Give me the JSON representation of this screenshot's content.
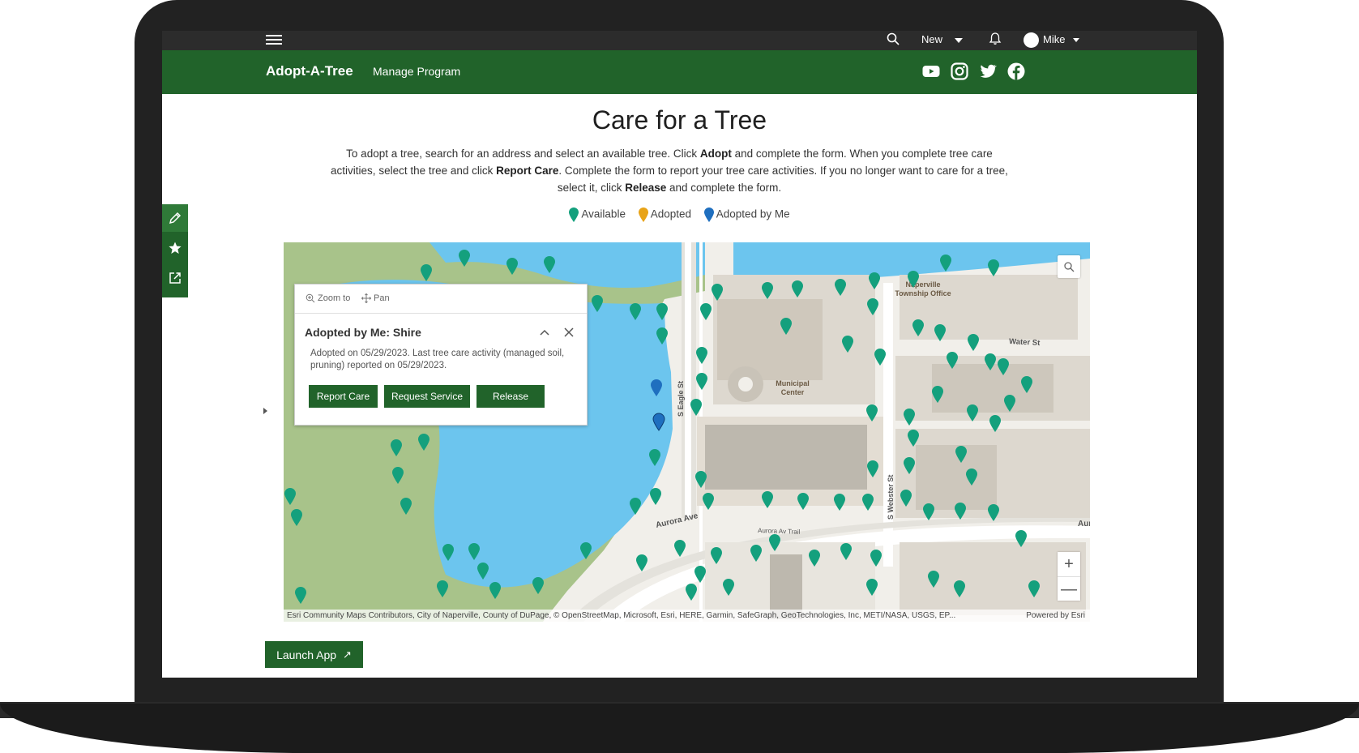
{
  "topbar": {
    "new_label": "New",
    "user_name": "Mike"
  },
  "header": {
    "brand": "Adopt-A-Tree",
    "nav_link": "Manage Program",
    "social_icons": [
      "youtube-icon",
      "instagram-icon",
      "twitter-icon",
      "facebook-icon"
    ]
  },
  "page": {
    "title": "Care for a Tree",
    "intro_parts": {
      "p1": "To adopt a tree, search for an address and select an available tree. Click ",
      "b1": "Adopt",
      "p2": " and complete the form. When you complete tree care activities, select the tree and click ",
      "b2": "Report Care",
      "p3": ". Complete the form to report your tree care activities. If you no longer want to care for a tree, select it, click ",
      "b3": "Release",
      "p4": " and complete the form."
    },
    "legend": {
      "available": "Available",
      "adopted": "Adopted",
      "adopted_by_me": "Adopted by Me"
    },
    "launch_label": "Launch App"
  },
  "colors": {
    "brand_green": "#21632a",
    "available": "#14a07d",
    "adopted": "#e8a317",
    "adopted_by_me": "#1f6fbf",
    "water": "#6cc5ee",
    "park": "#a8c38a"
  },
  "popup": {
    "zoom_label": "Zoom to",
    "pan_label": "Pan",
    "title": "Adopted by Me: Shire",
    "body": "Adopted on 05/29/2023. Last tree care activity (managed soil, pruning) reported on 05/29/2023.",
    "buttons": {
      "report": "Report Care",
      "request": "Request Service",
      "release": "Release"
    }
  },
  "map": {
    "labels": {
      "township_l1": "Naperville",
      "township_l2": "Township Office",
      "water_st": "Water St",
      "municipal_l1": "Municipal",
      "municipal_l2": "Center",
      "eagle_st": "S Eagle St",
      "webster_st": "S Webster St",
      "aurora_ave": "Aurora Ave",
      "aurora_trail": "Aurora Av Trail",
      "aurora_right": "Aur"
    },
    "attribution": "Esri Community Maps Contributors, City of Naperville, County of DuPage, © OpenStreetMap, Microsoft, Esri, HERE, Garmin, SafeGraph, GeoTechnologies, Inc, METI/NASA, USGS, EP...",
    "powered_by": "Powered by Esri",
    "zoom_in": "+",
    "zoom_out": "—"
  }
}
